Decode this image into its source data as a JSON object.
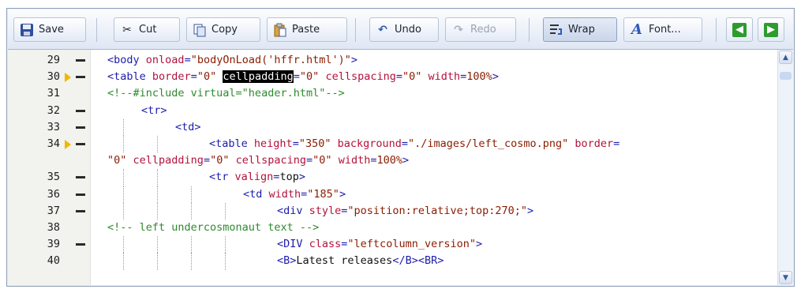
{
  "toolbar": {
    "save": "Save",
    "cut": "Cut",
    "copy": "Copy",
    "paste": "Paste",
    "undo": "Undo",
    "redo": "Redo",
    "wrap": "Wrap",
    "font": "Font...",
    "colors": {
      "accent": "#3b5998",
      "nav_green": "#2e9b2e"
    }
  },
  "lines": [
    {
      "n": "29",
      "fold": true,
      "arrow": false,
      "indent": 0,
      "segs": [
        [
          "plain",
          ""
        ],
        [
          "tag",
          "<body "
        ],
        [
          "attr",
          "onload"
        ],
        [
          "tag",
          "="
        ],
        [
          "val",
          "\"bodyOnLoad('hffr.html')\""
        ],
        [
          "tag",
          ">"
        ]
      ]
    },
    {
      "n": "30",
      "fold": true,
      "arrow": true,
      "indent": 0,
      "segs": [
        [
          "tag",
          "<table "
        ],
        [
          "attr",
          "border"
        ],
        [
          "tag",
          "="
        ],
        [
          "val",
          "\"0\""
        ],
        [
          "plain",
          " "
        ],
        [
          "hl",
          "cellpadding"
        ],
        [
          "tag",
          "="
        ],
        [
          "val",
          "\"0\""
        ],
        [
          "plain",
          " "
        ],
        [
          "attr",
          "cellspacing"
        ],
        [
          "tag",
          "="
        ],
        [
          "val",
          "\"0\""
        ],
        [
          "plain",
          " "
        ],
        [
          "attr",
          "width"
        ],
        [
          "tag",
          "="
        ],
        [
          "val",
          "100%"
        ],
        [
          "tag",
          ">"
        ]
      ]
    },
    {
      "n": "31",
      "fold": false,
      "arrow": false,
      "indent": 0,
      "segs": [
        [
          "com",
          "<!--#include virtual=\"header.html\"-->"
        ]
      ]
    },
    {
      "n": "32",
      "fold": true,
      "arrow": false,
      "indent": 1,
      "segs": [
        [
          "tag",
          "<tr>"
        ]
      ]
    },
    {
      "n": "33",
      "fold": true,
      "arrow": false,
      "indent": 2,
      "segs": [
        [
          "tag",
          "<td>"
        ]
      ]
    },
    {
      "n": "34",
      "fold": true,
      "arrow": true,
      "indent": 3,
      "segs": [
        [
          "tag",
          "<table "
        ],
        [
          "attr",
          "height"
        ],
        [
          "tag",
          "="
        ],
        [
          "val",
          "\"350\""
        ],
        [
          "plain",
          " "
        ],
        [
          "attr",
          "background"
        ],
        [
          "tag",
          "="
        ],
        [
          "val",
          "\"./images/left_cosmo.png\""
        ],
        [
          "plain",
          " "
        ],
        [
          "attr",
          "border"
        ],
        [
          "tag",
          "="
        ]
      ]
    },
    {
      "n": "",
      "fold": false,
      "arrow": false,
      "indent": 0,
      "segs": [
        [
          "val",
          "\"0\""
        ],
        [
          "plain",
          " "
        ],
        [
          "attr",
          "cellpadding"
        ],
        [
          "tag",
          "="
        ],
        [
          "val",
          "\"0\""
        ],
        [
          "plain",
          " "
        ],
        [
          "attr",
          "cellspacing"
        ],
        [
          "tag",
          "="
        ],
        [
          "val",
          "\"0\""
        ],
        [
          "plain",
          " "
        ],
        [
          "attr",
          "width"
        ],
        [
          "tag",
          "="
        ],
        [
          "val",
          "100%"
        ],
        [
          "tag",
          ">"
        ]
      ]
    },
    {
      "n": "35",
      "fold": true,
      "arrow": false,
      "indent": 3,
      "segs": [
        [
          "tag",
          "<tr "
        ],
        [
          "attr",
          "valign"
        ],
        [
          "tag",
          "="
        ],
        [
          "plain",
          "top"
        ],
        [
          "tag",
          ">"
        ]
      ]
    },
    {
      "n": "36",
      "fold": true,
      "arrow": false,
      "indent": 4,
      "segs": [
        [
          "tag",
          "<td "
        ],
        [
          "attr",
          "width"
        ],
        [
          "tag",
          "="
        ],
        [
          "val",
          "\"185\""
        ],
        [
          "tag",
          ">"
        ]
      ]
    },
    {
      "n": "37",
      "fold": true,
      "arrow": false,
      "indent": 5,
      "segs": [
        [
          "tag",
          "<div "
        ],
        [
          "attr",
          "style"
        ],
        [
          "tag",
          "="
        ],
        [
          "val",
          "\"position:relative;top:270;\""
        ],
        [
          "tag",
          ">"
        ]
      ]
    },
    {
      "n": "38",
      "fold": false,
      "arrow": false,
      "indent": 0,
      "segs": [
        [
          "com",
          "<!-- left undercosmonaut text -->"
        ]
      ]
    },
    {
      "n": "39",
      "fold": true,
      "arrow": false,
      "indent": 5,
      "segs": [
        [
          "tag",
          "<DIV "
        ],
        [
          "attr",
          "class"
        ],
        [
          "tag",
          "="
        ],
        [
          "val",
          "\"leftcolumn_version\""
        ],
        [
          "tag",
          ">"
        ]
      ]
    },
    {
      "n": "40",
      "fold": false,
      "arrow": false,
      "indent": 5,
      "segs": [
        [
          "tag",
          "<B>"
        ],
        [
          "plain",
          "Latest releases"
        ],
        [
          "tag",
          "</B><BR>"
        ]
      ]
    }
  ]
}
